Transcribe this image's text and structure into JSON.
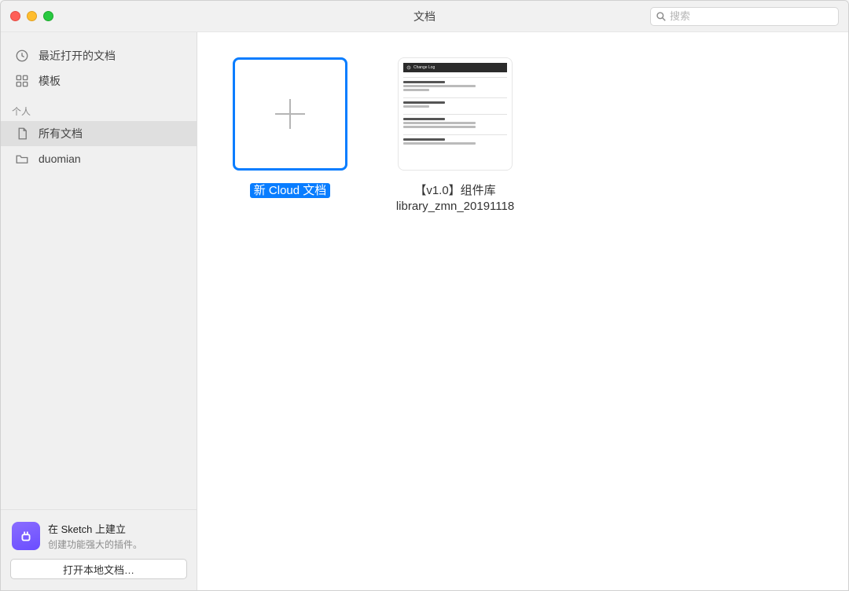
{
  "titlebar": {
    "title": "文档",
    "search_placeholder": "搜索"
  },
  "sidebar": {
    "items": [
      {
        "icon": "clock",
        "label": "最近打开的文档"
      },
      {
        "icon": "grid",
        "label": "模板"
      }
    ],
    "personal_section": "个人",
    "personal_items": [
      {
        "icon": "doc",
        "label": "所有文档",
        "selected": true
      },
      {
        "icon": "folder",
        "label": "duomian"
      }
    ],
    "upsell": {
      "title": "在 Sketch 上建立",
      "subtitle": "创建功能强大的插件。"
    },
    "open_local_button": "打开本地文档…"
  },
  "documents": {
    "new_doc_label": "新 Cloud 文档",
    "items": [
      {
        "preview_header": "Change Log",
        "label_line1": "【v1.0】组件库",
        "label_line2": "library_zmn_20191118"
      }
    ]
  }
}
